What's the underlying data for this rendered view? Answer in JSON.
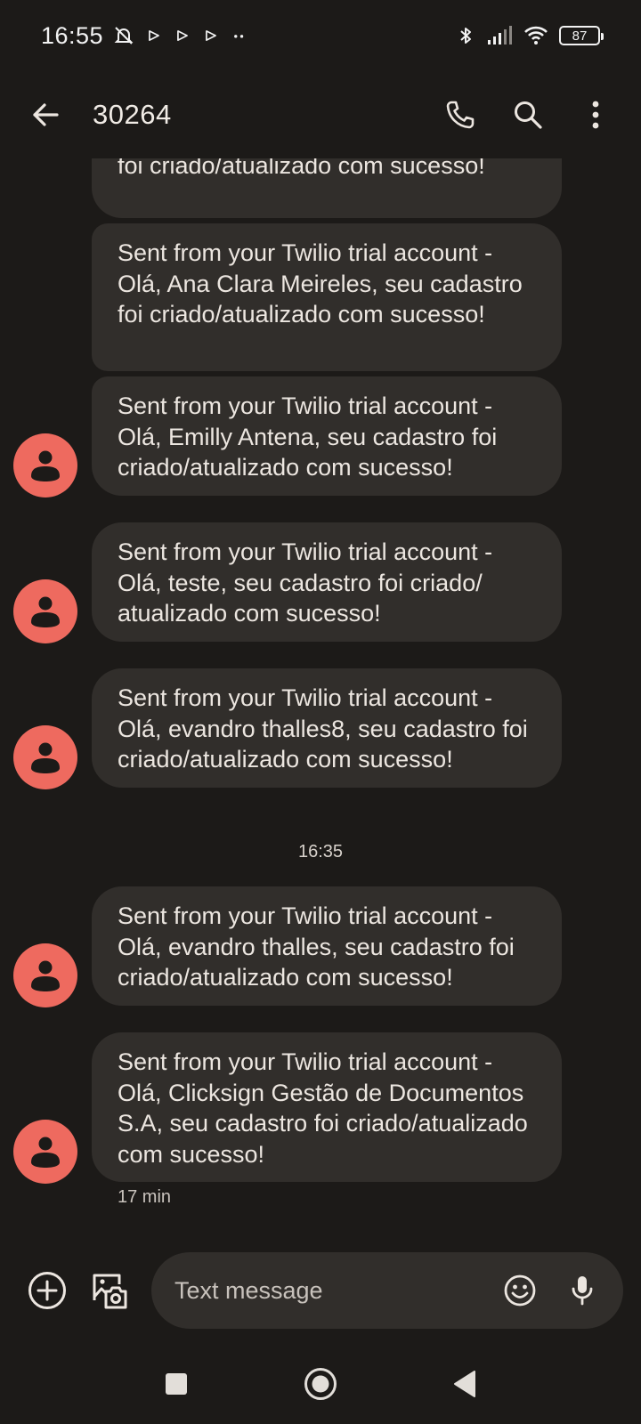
{
  "status_bar": {
    "time": "16:55",
    "battery": "87"
  },
  "header": {
    "contact": "30264"
  },
  "messages": [
    {
      "text": "Sent from your Twilio trial account - Olá, Luiz Henrique Veles, seu cadastro foi criado/atualizado com sucesso!"
    },
    {
      "text": "Sent from your Twilio trial account - Olá, Ana Clara Meireles, seu cadastro foi criado/atualizado com sucesso!"
    },
    {
      "text": "Sent from your Twilio trial account - Olá, Emilly Antena, seu cadastro foi criado/atualizado com sucesso!"
    },
    {
      "text": "Sent from your Twilio trial account - Olá, teste, seu cadastro foi criado/ atualizado com sucesso!"
    },
    {
      "text": "Sent from your Twilio trial account - Olá, evandro thalles8, seu cadastro foi criado/atualizado com sucesso!"
    },
    {
      "text": "Sent from your Twilio trial account - Olá, evandro thalles, seu cadastro foi criado/atualizado com sucesso!"
    },
    {
      "text": "Sent from your Twilio trial account - Olá, Clicksign Gestão de Documentos S.A, seu cadastro foi criado/atualizado com sucesso!"
    }
  ],
  "time_divider": "16:35",
  "last_message_time": "17 min",
  "compose": {
    "placeholder": "Text message"
  },
  "colors": {
    "background": "#1c1a18",
    "bubble": "#312e2b",
    "avatar": "#ee6a5f",
    "text": "#ece6e0"
  }
}
